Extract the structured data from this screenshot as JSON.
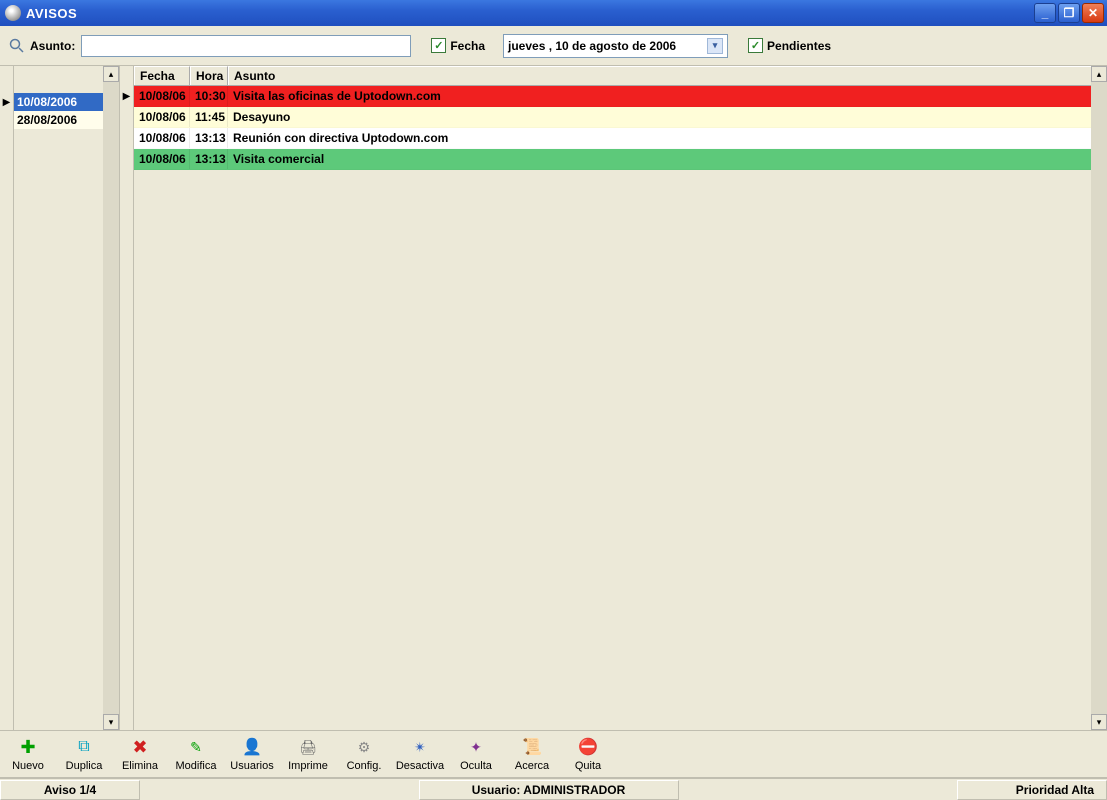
{
  "window": {
    "title": "AVISOS"
  },
  "search": {
    "label": "Asunto:",
    "value": ""
  },
  "filter": {
    "fecha_check": "Fecha",
    "fecha_value": "jueves  , 10 de    agosto    de 2006",
    "pendientes_check": "Pendientes"
  },
  "sidebar": {
    "dates": [
      {
        "value": "10/08/2006",
        "selected": true
      },
      {
        "value": "28/08/2006",
        "selected": false
      }
    ]
  },
  "table": {
    "headers": {
      "fecha": "Fecha",
      "hora": "Hora",
      "asunto": "Asunto"
    },
    "rows": [
      {
        "fecha": "10/08/06",
        "hora": "10:30",
        "asunto": "Visita las oficinas de Uptodown.com",
        "priority": "red",
        "current": true
      },
      {
        "fecha": "10/08/06",
        "hora": "11:45",
        "asunto": "Desayuno",
        "priority": "yellow",
        "current": false
      },
      {
        "fecha": "10/08/06",
        "hora": "13:13",
        "asunto": "Reunión con directiva Uptodown.com",
        "priority": "white",
        "current": false
      },
      {
        "fecha": "10/08/06",
        "hora": "13:13",
        "asunto": "Visita comercial",
        "priority": "green",
        "current": false
      }
    ]
  },
  "toolbar": {
    "nuevo": "Nuevo",
    "duplica": "Duplica",
    "elimina": "Elimina",
    "modifica": "Modifica",
    "usuarios": "Usuarios",
    "imprime": "Imprime",
    "config": "Config.",
    "desactiva": "Desactiva",
    "oculta": "Oculta",
    "acerca": "Acerca",
    "quita": "Quita"
  },
  "status": {
    "aviso": "Aviso 1/4",
    "usuario": "Usuario: ADMINISTRADOR",
    "prioridad": "Prioridad Alta"
  }
}
